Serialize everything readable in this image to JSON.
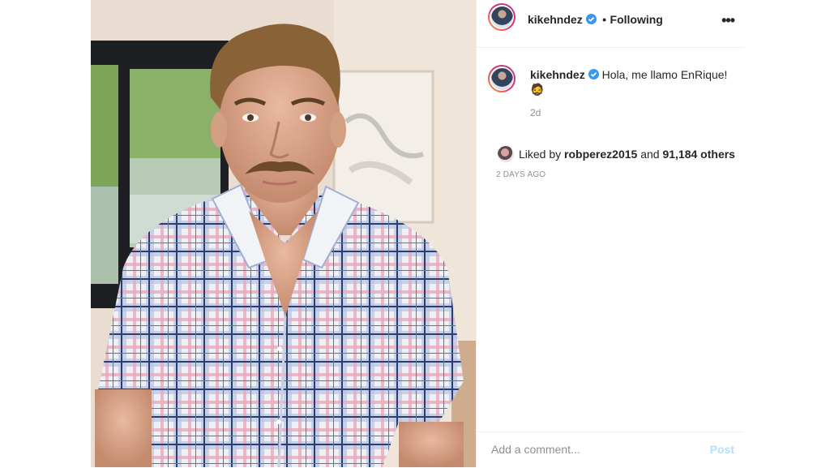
{
  "header": {
    "username": "kikehndez",
    "separator": "•",
    "follow_status": "Following",
    "more_label": "•••"
  },
  "caption": {
    "username": "kikehndez",
    "text": "Hola, me llamo EnRique!",
    "emoji": "🧔",
    "time": "2d"
  },
  "likes": {
    "prefix": "Liked by",
    "user": "robperez2015",
    "conjunction": "and",
    "count": "91,184 others"
  },
  "posted_ago": "2 DAYS AGO",
  "comment": {
    "placeholder": "Add a comment...",
    "post_label": "Post"
  },
  "colors": {
    "verified": "#3897f0",
    "post_disabled": "#b2dffc",
    "muted": "#8e8e8e"
  }
}
